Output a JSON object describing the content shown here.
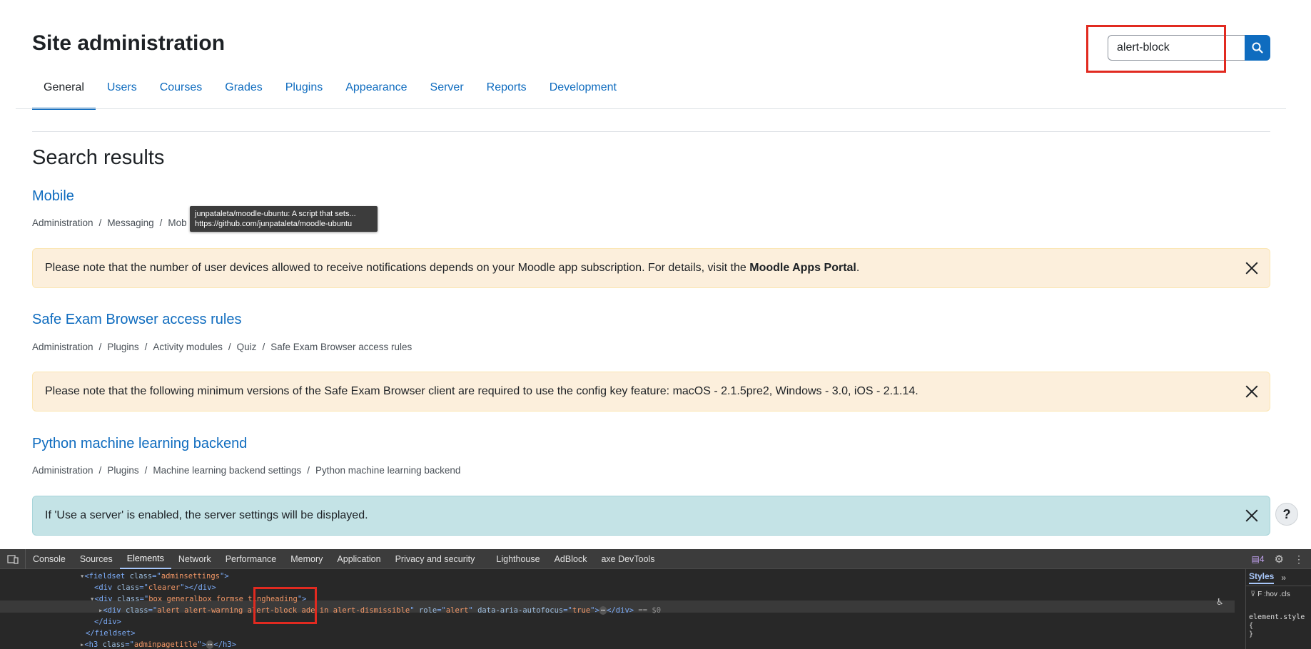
{
  "header": {
    "title": "Site administration"
  },
  "search": {
    "value": "alert-block"
  },
  "tabs": [
    "General",
    "Users",
    "Courses",
    "Grades",
    "Plugins",
    "Appearance",
    "Server",
    "Reports",
    "Development"
  ],
  "results_heading": "Search results",
  "results": [
    {
      "title": "Mobile",
      "breadcrumb": [
        "Administration",
        "Messaging",
        "Mob"
      ],
      "alert": {
        "pre": "Please note that the number of user devices allowed to receive notifications depends on your Moodle app subscription. For details, visit the ",
        "link": "Moodle Apps Portal",
        "post": "."
      }
    },
    {
      "title": "Safe Exam Browser access rules",
      "breadcrumb": [
        "Administration",
        "Plugins",
        "Activity modules",
        "Quiz",
        "Safe Exam Browser access rules"
      ],
      "alert": {
        "pre": "Please note that the following minimum versions of the Safe Exam Browser client are required to use the config key feature: macOS - 2.1.5pre2, Windows - 3.0, iOS - 2.1.14."
      }
    },
    {
      "title": "Python machine learning backend",
      "breadcrumb": [
        "Administration",
        "Plugins",
        "Machine learning backend settings",
        "Python machine learning backend"
      ],
      "alert": {
        "pre": "If 'Use a server' is enabled, the server settings will be displayed."
      }
    }
  ],
  "tooltip": {
    "line1": "junpataleta/moodle-ubuntu: A script that sets...",
    "line2": "https://github.com/junpataleta/moodle-ubuntu"
  },
  "help_button": "?",
  "devtools": {
    "tabs": [
      "Console",
      "Sources",
      "Elements",
      "Network",
      "Performance",
      "Memory",
      "Application",
      "Privacy and security",
      "Lighthouse",
      "AdBlock",
      "axe DevTools"
    ],
    "active_tab": "Elements",
    "issues_count": "4",
    "code": {
      "l1_tag": "fieldset",
      "l1_attr": "class",
      "l1_val": "adminsettings",
      "l2_tag": "div",
      "l2_attr": "class",
      "l2_val": "clearer",
      "l3_tag": "div",
      "l3_attr": "class",
      "l3_val": "box generalbox formse tingheading",
      "l4_tag": "div",
      "l4_attr1": "class",
      "l4_val1": "alert alert-warning alert-block ade in  alert-dismissible",
      "l4_attr2": "role",
      "l4_val2": "alert",
      "l4_attr3": "data-aria-autofocus",
      "l4_val3": "true",
      "l4_suffix": "== $0",
      "l5_tag": "/div",
      "l6_tag": "/fieldset",
      "l7_tag": "h3",
      "l7_attr": "class",
      "l7_val": "adminpagetitle"
    },
    "styles": {
      "title": "Styles",
      "filter": "F",
      "hov": ":hov",
      "cls": ".cls",
      "rule": "element.style",
      "brace_open": "{",
      "brace_close": "}"
    }
  }
}
